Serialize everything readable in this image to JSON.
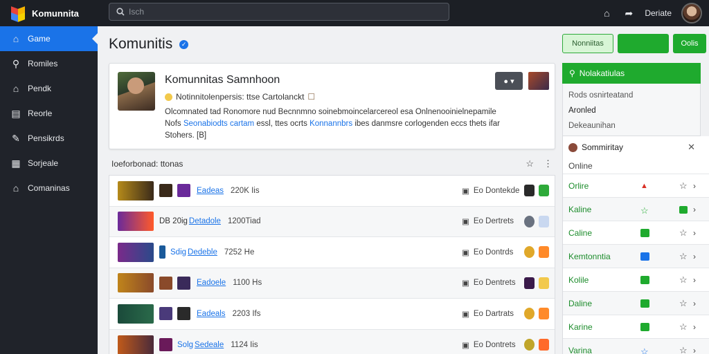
{
  "app": {
    "name": "Komunnita"
  },
  "search": {
    "placeholder": "Isch"
  },
  "user": {
    "name": "Deriate"
  },
  "sidebar": {
    "items": [
      {
        "label": "Game",
        "icon": "home-icon",
        "active": true
      },
      {
        "label": "Romiles",
        "icon": "search-icon"
      },
      {
        "label": "Pendk",
        "icon": "home-icon"
      },
      {
        "label": "Reorle",
        "icon": "calendar-icon"
      },
      {
        "label": "Pensikrds",
        "icon": "edit-icon"
      },
      {
        "label": "Sorjeale",
        "icon": "grid-icon"
      },
      {
        "label": "Comaninas",
        "icon": "home-icon"
      }
    ]
  },
  "main": {
    "title": "Komunitis",
    "card": {
      "title": "Komunnitas Samnhoon",
      "subtitle": "Notinnitolenpersis: ttse Cartolanckt",
      "desc_line1": "Olcomnated tad Ronomore nud Becnnmno soinebmoincelarcereol esa Onlnenooinielnepamile",
      "desc_line2_pre": "Nofs",
      "desc_link1": "Seonabiodts cartam",
      "desc_mid1": "essl,",
      "desc_mid2": "ttes ocrts",
      "desc_link2": "Konnannbrs",
      "desc_line2_post": "ibes danmsre corlogenden eccs thets ifar",
      "desc_line3": "Stohers. [B]"
    },
    "list_title": "Ioeforbonad: ttonas",
    "rows": [
      {
        "prefix": "",
        "link": "Eadeas",
        "size": "220K Iis",
        "status": "Eo Dontekde",
        "colors": [
          "#b58a1a",
          "#3a2a1a",
          "#6a2a9a"
        ],
        "badges": [
          "#2a2a2a",
          "#2eaa3a"
        ],
        "alt": false
      },
      {
        "prefix": "DB 20ig",
        "link": "Detadole",
        "size": "1200Tiad",
        "status": "Eo Dertrets",
        "colors": [
          "#6a2a9a",
          "#ff5a2a",
          "#2a1a3a"
        ],
        "badges": [
          "#6a7280",
          "#c9d8f0"
        ],
        "alt": true
      },
      {
        "prefix": "Sdig",
        "link": "Dedeble",
        "size": "7252 He",
        "status": "Eo Dontrds",
        "colors": [
          "#7a2a8a",
          "#2a4a8a",
          "#1a5a9a"
        ],
        "badges": [
          "#e0a82a",
          "#ff8a2a"
        ],
        "alt": false
      },
      {
        "prefix": "",
        "link": "Eadoele",
        "size": "1100 Hs",
        "status": "Eo Dentrets",
        "colors": [
          "#c0841a",
          "#8a4a2a",
          "#3a2a5a"
        ],
        "badges": [
          "#3a1a4a",
          "#f2c94c"
        ],
        "alt": true
      },
      {
        "prefix": "",
        "link": "Eadeals",
        "size": "2203 Ifs",
        "status": "Eo Dartrats",
        "colors": [
          "#1a4a3a",
          "#4a3a7a",
          "#2a2a2a"
        ],
        "badges": [
          "#e0a82a",
          "#ff8a2a"
        ],
        "alt": false
      },
      {
        "prefix": "Solg",
        "link": "Sedeale",
        "size": "1124 Iis",
        "status": "Eo Dontrets",
        "colors": [
          "#c05a1a",
          "#4a2a3a",
          "#6a1a5a"
        ],
        "badges": [
          "#c0a52a",
          "#ff6a2a"
        ],
        "alt": true
      }
    ]
  },
  "right": {
    "btn_light": "Nonniitas",
    "btn_green2": "Oolis",
    "panel_title": "Nolakatiulas",
    "panel_line1": "Rods osnirteatand",
    "panel_line2": "Aronled",
    "panel_line3": "Dekeaunihan",
    "community_title": "Sommiritay",
    "community_sub": "Online",
    "members": [
      {
        "name": "Orlire",
        "icon_color": "#d93025",
        "alt": false
      },
      {
        "name": "Kaline",
        "icon_color": "#1faa2e",
        "alt": true
      },
      {
        "name": "Caline",
        "icon_color": "#1faa2e",
        "alt": false
      },
      {
        "name": "Kemtonntia",
        "icon_color": "#1a73e8",
        "alt": true
      },
      {
        "name": "Kolile",
        "icon_color": "#1faa2e",
        "alt": false
      },
      {
        "name": "Daline",
        "icon_color": "#1faa2e",
        "alt": true
      },
      {
        "name": "Karine",
        "icon_color": "#1faa2e",
        "alt": false
      },
      {
        "name": "Varina",
        "icon_color": "#1a73e8",
        "alt": true
      }
    ]
  }
}
